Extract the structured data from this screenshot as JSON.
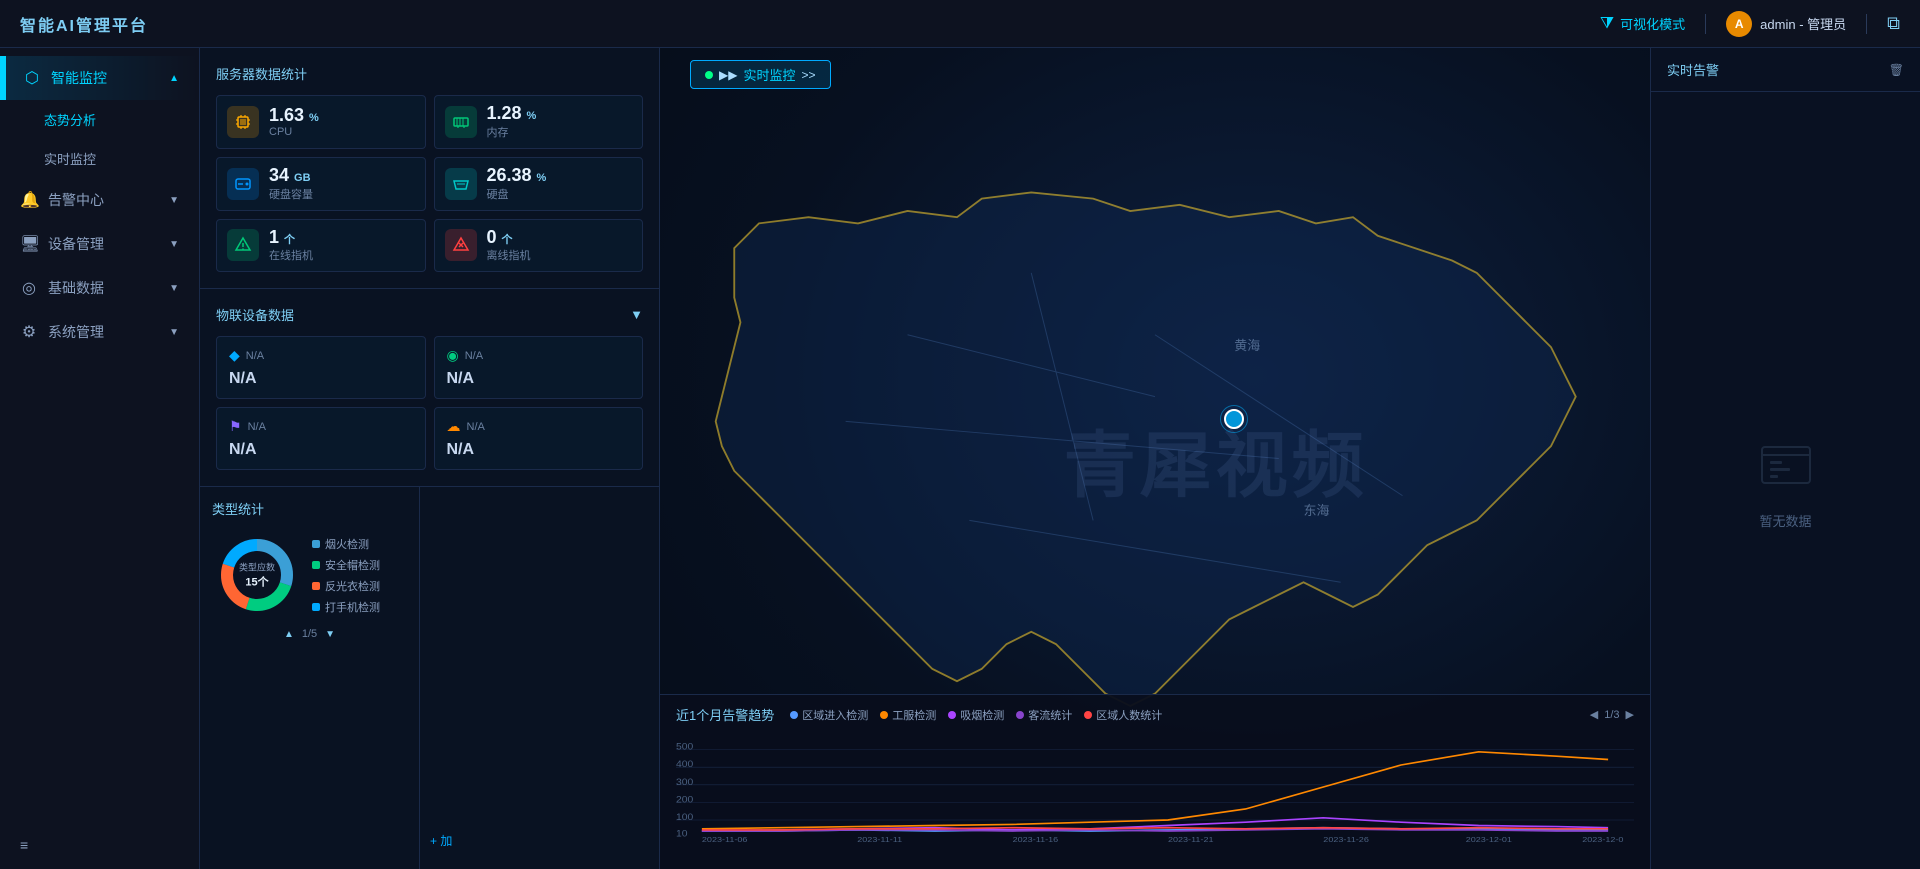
{
  "app": {
    "title": "智能AI管理平台",
    "visualize_mode": "可视化模式",
    "admin": "admin - 管理员",
    "admin_initial": "A"
  },
  "sidebar": {
    "items": [
      {
        "id": "smart-monitor",
        "label": "智能监控",
        "icon": "⬡",
        "expanded": true,
        "active": true
      },
      {
        "id": "alert-center",
        "label": "告警中心",
        "icon": "🔔",
        "expanded": false
      },
      {
        "id": "device-mgmt",
        "label": "设备管理",
        "icon": "🖥",
        "expanded": false
      },
      {
        "id": "basic-data",
        "label": "基础数据",
        "icon": "◎",
        "expanded": false
      },
      {
        "id": "sys-mgmt",
        "label": "系统管理",
        "icon": "⚙",
        "expanded": false
      }
    ],
    "sub_items": [
      {
        "id": "trend-analysis",
        "label": "态势分析",
        "active": true
      },
      {
        "id": "realtime-monitor",
        "label": "实时监控",
        "active": false
      }
    ],
    "bottom_icon": "≡"
  },
  "server_stats": {
    "title": "服务器数据统计",
    "items": [
      {
        "id": "cpu",
        "label": "CPU",
        "value": "1.63",
        "unit": "%",
        "icon": "cpu"
      },
      {
        "id": "memory",
        "label": "内存",
        "value": "1.28",
        "unit": "%",
        "icon": "mem"
      },
      {
        "id": "disk_total",
        "label": "硬盘容量",
        "value": "34",
        "unit": "GB",
        "icon": "disk-t"
      },
      {
        "id": "disk",
        "label": "硬盘",
        "value": "26.38",
        "unit": "%",
        "icon": "disk"
      },
      {
        "id": "online",
        "label": "在线指机",
        "value": "1",
        "unit": "个",
        "icon": "online"
      },
      {
        "id": "offline",
        "label": "离线指机",
        "value": "0",
        "unit": "个",
        "icon": "offline"
      }
    ]
  },
  "iot": {
    "title": "物联设备数据",
    "items": [
      {
        "id": "iot1",
        "label": "N/A",
        "value": "N/A",
        "icon_class": "blue"
      },
      {
        "id": "iot2",
        "label": "N/A",
        "value": "N/A",
        "icon_class": "green"
      },
      {
        "id": "iot3",
        "label": "N/A",
        "value": "N/A",
        "icon_class": "purple"
      },
      {
        "id": "iot4",
        "label": "N/A",
        "value": "N/A",
        "icon_class": "orange"
      }
    ]
  },
  "type_stats": {
    "title": "类型统计",
    "center_label": "类型应数",
    "center_value": "15个",
    "pagination": "1/5",
    "legend": [
      {
        "color": "#3b9fd6",
        "label": "烟火检测"
      },
      {
        "color": "#00cc80",
        "label": "安全帽检测"
      },
      {
        "color": "#ff6633",
        "label": "反光衣检测"
      },
      {
        "color": "#00aaff",
        "label": "打手机检测"
      }
    ],
    "donut_segments": [
      {
        "color": "#3b9fd6",
        "value": 30
      },
      {
        "color": "#00cc80",
        "value": 25
      },
      {
        "color": "#ff6633",
        "value": 25
      },
      {
        "color": "#00aaff",
        "value": 20
      }
    ]
  },
  "map": {
    "realtime_label": "实时监控",
    "sea_label": "东海",
    "lake_label": "黄海",
    "watermark": "青犀视频"
  },
  "trend_chart": {
    "title": "近1个月告警趋势",
    "legend": [
      {
        "color": "#5599ff",
        "label": "区域进入检测"
      },
      {
        "color": "#ff8800",
        "label": "工服检测"
      },
      {
        "color": "#aa44ff",
        "label": "吸烟检测"
      },
      {
        "color": "#8844cc",
        "label": "客流统计"
      },
      {
        "color": "#ff4444",
        "label": "区域人数统计"
      }
    ],
    "pagination": "1/3",
    "x_labels": [
      "2023-11-06",
      "2023-11-11",
      "2023-11-16",
      "2023-11-21",
      "2023-11-26",
      "2023-12-01",
      "2023-12-0"
    ],
    "y_labels": [
      "500",
      "400",
      "300",
      "200",
      "100",
      "10"
    ]
  },
  "realtime_alert": {
    "title": "实时告警",
    "empty_text": "暂无数据"
  }
}
